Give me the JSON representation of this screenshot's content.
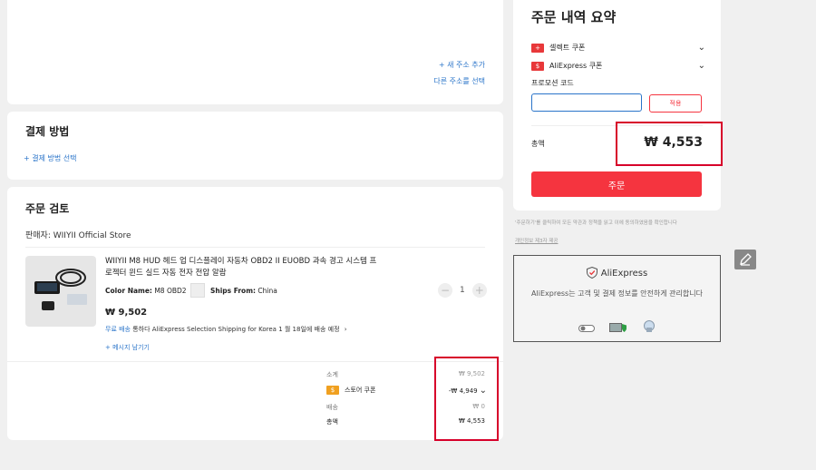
{
  "address": {
    "add_new": "+ 새 주소 추가",
    "choose_other": "다른 주소를 선택"
  },
  "payment": {
    "title": "결제 방법",
    "select": "+ 결제 방법 선택"
  },
  "review": {
    "title": "주문 검토",
    "seller": "판매자: WIIYII Official Store",
    "product": {
      "title": "WIIYII M8 HUD 헤드 업 디스플레이 자동차 OBD2 II EUOBD 과속 경고 시스템 프로젝터 윈드 실드 자동 전자 전압 알람",
      "color_label": "Color Name:",
      "color_value": "M8 OBD2",
      "ships_label": "Ships From:",
      "ships_value": "China",
      "price": "₩ 9,502",
      "qty": "1",
      "shipping_free": "무료 배송",
      "shipping_via": "통하다 AliExpress Selection Shipping for Korea",
      "delivery": "1 월 18일에 배송 예정",
      "leave_message": "+ 메시지 남기기"
    },
    "totals": {
      "subtotal_label": "소계",
      "subtotal_value": "₩ 9,502",
      "store_coupon_label": "스토어 쿠폰",
      "store_coupon_value": "-₩ 4,949",
      "shipping_label": "배송",
      "shipping_value": "₩ 0",
      "total_label": "총액",
      "total_value": "₩ 4,553"
    }
  },
  "summary": {
    "title": "주문 내역 요약",
    "select_coupon": "셀렉트 쿠폰",
    "ae_coupon": "AliExpress 쿠폰",
    "promo_label": "프로모션 코드",
    "promo_placeholder": "",
    "apply": "적용",
    "total_label": "총액",
    "total_value": "₩ 4,553",
    "order_button": "주문",
    "terms_line1": "'주문하기'를 클릭하여 모든 약관과 정책을 읽고 이에 동의하였음을 확인합니다",
    "terms_line2": "개인정보 제3자 제공"
  },
  "security": {
    "brand": "AliExpress",
    "message": "AliExpress는 고객 및 결제 정보를 안전하게 관리합니다"
  },
  "colors": {
    "accent": "#f5343f",
    "highlight_border": "#d7002a",
    "link": "#2a74c9"
  }
}
